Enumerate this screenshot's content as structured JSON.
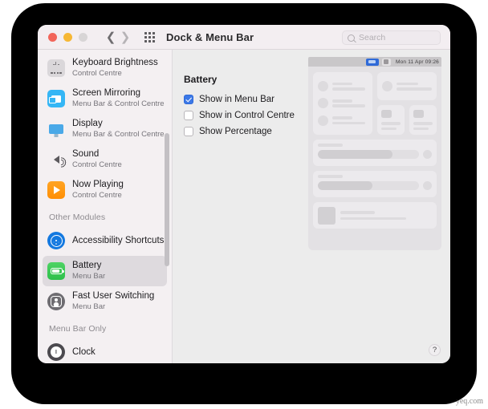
{
  "window": {
    "title": "Dock & Menu Bar",
    "traffic_lights": [
      "close",
      "minimise",
      "zoom-disabled"
    ],
    "nav_back_icon": "chevron-left-icon",
    "nav_forward_icon": "chevron-right-icon",
    "grid_icon": "grid-view-icon",
    "search": {
      "placeholder": "Search",
      "value": "",
      "icon": "search-icon"
    }
  },
  "sidebar": {
    "items": [
      {
        "label": "Keyboard Brightness",
        "sub": "Control Centre",
        "icon": "keyboard-brightness-icon",
        "selected": false
      },
      {
        "label": "Screen Mirroring",
        "sub": "Menu Bar & Control Centre",
        "icon": "screen-mirroring-icon",
        "selected": false
      },
      {
        "label": "Display",
        "sub": "Menu Bar & Control Centre",
        "icon": "display-icon",
        "selected": false
      },
      {
        "label": "Sound",
        "sub": "Control Centre",
        "icon": "sound-icon",
        "selected": false
      },
      {
        "label": "Now Playing",
        "sub": "Control Centre",
        "icon": "now-playing-icon",
        "selected": false
      }
    ],
    "group_other_modules": "Other Modules",
    "other_modules": [
      {
        "label": "Accessibility Shortcuts",
        "sub": "",
        "icon": "accessibility-icon",
        "selected": false
      },
      {
        "label": "Battery",
        "sub": "Menu Bar",
        "icon": "battery-icon",
        "selected": true
      },
      {
        "label": "Fast User Switching",
        "sub": "Menu Bar",
        "icon": "fast-user-switching-icon",
        "selected": false
      }
    ],
    "group_menu_bar_only": "Menu Bar Only",
    "menu_bar_only": [
      {
        "label": "Clock",
        "sub": "",
        "icon": "clock-icon",
        "selected": false
      }
    ]
  },
  "main": {
    "pane_title": "Battery",
    "checkboxes": [
      {
        "label": "Show in Menu Bar",
        "checked": true
      },
      {
        "label": "Show in Control Centre",
        "checked": false
      },
      {
        "label": "Show Percentage",
        "checked": false
      }
    ],
    "help_label": "?"
  },
  "preview": {
    "menu_bar_clock": "Mon 11 Apr  09:26",
    "battery_icon": "battery-menu-icon",
    "control_centre_icon": "control-centre-icon",
    "accent_color": "#2f6ad8"
  },
  "watermark": "yeq.com"
}
